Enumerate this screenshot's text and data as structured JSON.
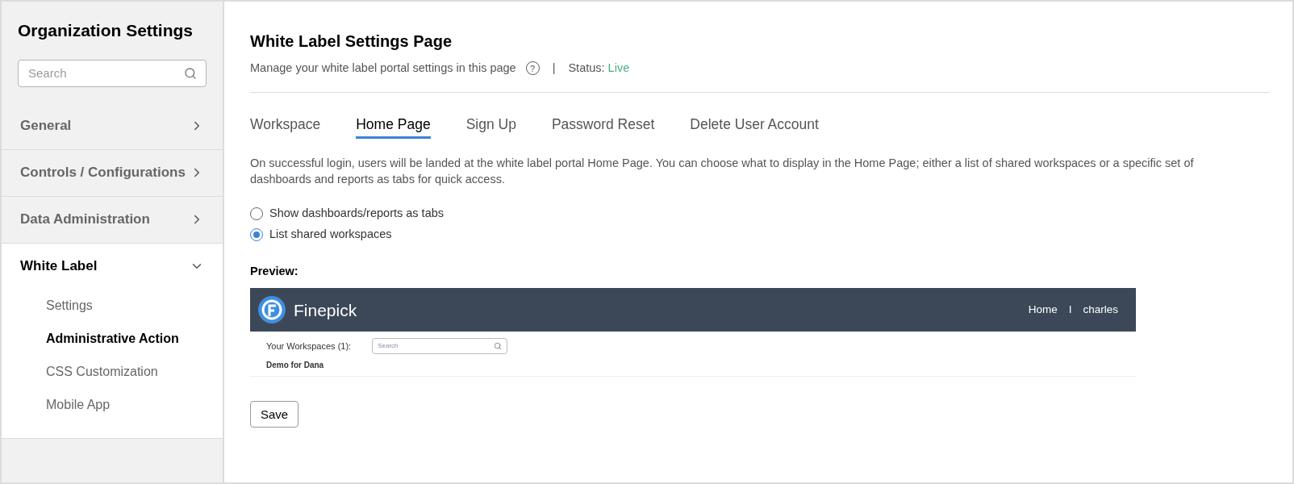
{
  "sidebar": {
    "title": "Organization Settings",
    "search": {
      "placeholder": "Search"
    },
    "items": [
      {
        "label": "General",
        "expanded": false
      },
      {
        "label": "Controls / Configurations",
        "expanded": false
      },
      {
        "label": "Data Administration",
        "expanded": false
      },
      {
        "label": "White Label",
        "expanded": true,
        "children": [
          {
            "label": "Settings",
            "selected": false
          },
          {
            "label": "Administrative Action",
            "selected": true
          },
          {
            "label": "CSS Customization",
            "selected": false
          },
          {
            "label": "Mobile App",
            "selected": false
          }
        ]
      }
    ]
  },
  "header": {
    "title": "White Label Settings Page",
    "subtitle": "Manage your white label portal settings in this page",
    "help": "?",
    "separator": "|",
    "status_label": "Status:",
    "status_value": "Live"
  },
  "tabs": [
    {
      "label": "Workspace",
      "selected": false
    },
    {
      "label": "Home Page",
      "selected": true
    },
    {
      "label": "Sign Up",
      "selected": false
    },
    {
      "label": "Password Reset",
      "selected": false
    },
    {
      "label": "Delete User Account",
      "selected": false
    }
  ],
  "description": "On successful login, users will be landed at the white label portal Home Page. You can choose what to display in the Home Page; either a list of shared workspaces or a specific set of dashboards and reports as tabs for quick access.",
  "options": [
    {
      "label": "Show dashboards/reports as tabs",
      "selected": false
    },
    {
      "label": "List shared workspaces",
      "selected": true
    }
  ],
  "preview": {
    "label": "Preview:",
    "brand": "Finepick",
    "nav": [
      "Home",
      "I",
      "charles"
    ],
    "workspaces_label": "Your Workspaces (1):",
    "search_placeholder": "Search",
    "workspace": "Demo for Dana"
  },
  "save_button": "Save"
}
